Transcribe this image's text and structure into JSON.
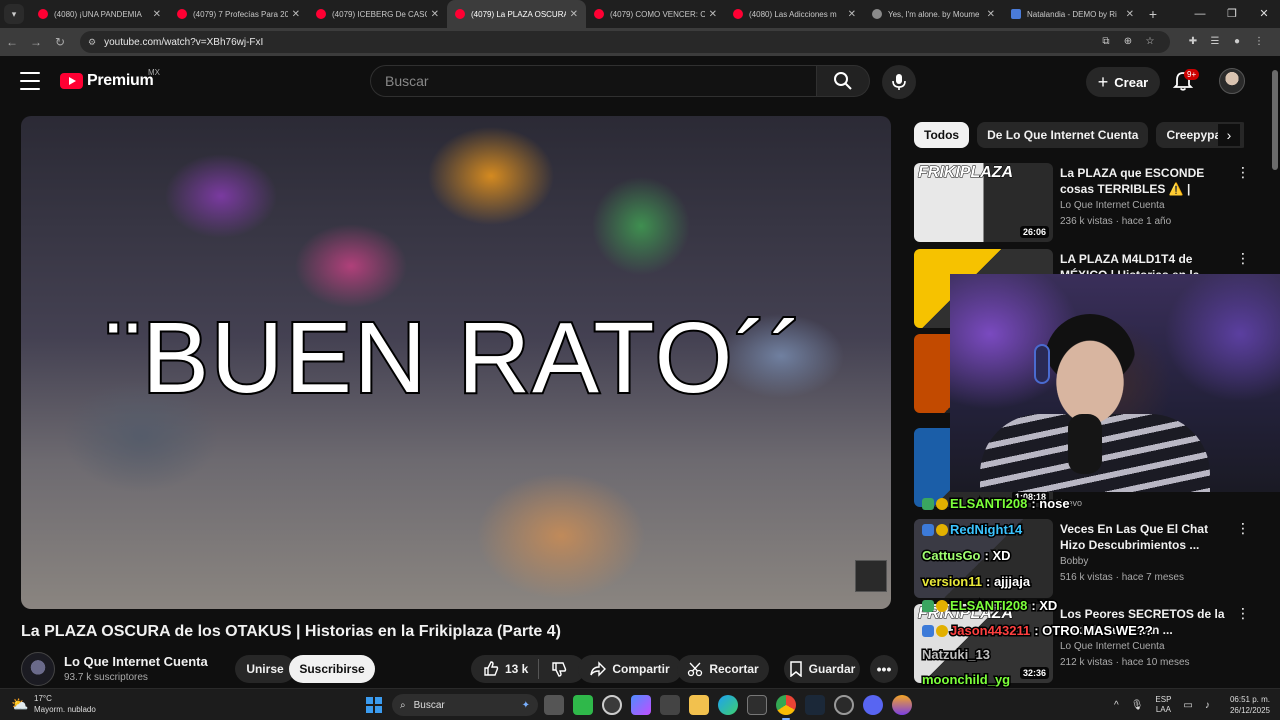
{
  "browser": {
    "tabs": [
      {
        "title": "(4080) ¡UNA PANDEMIA",
        "favicon": "youtube-icon"
      },
      {
        "title": "(4079) 7 Profecías Para 20",
        "favicon": "youtube-icon"
      },
      {
        "title": "(4079) ICEBERG De CASO",
        "favicon": "youtube-icon"
      },
      {
        "title": "(4079) La PLAZA OSCURA",
        "favicon": "youtube-icon",
        "active": true
      },
      {
        "title": "(4079) COMO VENCER: C",
        "favicon": "youtube-icon"
      },
      {
        "title": "(4080) Las Adicciones m",
        "favicon": "youtube-icon"
      },
      {
        "title": "Yes, I'm alone. by Moume",
        "favicon": "generic-icon"
      },
      {
        "title": "Natalandia - DEMO by Ri",
        "favicon": "blue-square-icon"
      }
    ],
    "url": "youtube.com/watch?v=XBh76wj-FxI"
  },
  "masthead": {
    "brand": "Premium",
    "region": "MX",
    "search_placeholder": "Buscar",
    "create_label": "Crear",
    "notif_count": "9+"
  },
  "player": {
    "overlay_text": "¨BUEN RATO´´"
  },
  "video": {
    "title": "La PLAZA OSCURA de los OTAKUS | Historias en la Frikiplaza (Parte 4)",
    "channel": "Lo Que Internet Cuenta",
    "subscribers": "93.7 k suscriptores",
    "join_label": "Unirse",
    "subscribe_label": "Suscribirse",
    "likes": "13 k",
    "share_label": "Compartir",
    "clip_label": "Recortar",
    "save_label": "Guardar"
  },
  "chips": [
    "Todos",
    "De Lo Que Internet Cuenta",
    "Creepypasta"
  ],
  "recommendations": [
    {
      "title": "La PLAZA que ESCONDE cosas TERRIBLES ⚠️ | Historias en l...",
      "channel": "Lo Que Internet Cuenta",
      "meta": "236 k vistas · hace 1 año",
      "duration": "26:06",
      "thumb_text": "FRIKIPLAZA"
    },
    {
      "title": "LA PLAZA M4LD1T4 de MÉXICO | Historias en la...",
      "channel": "",
      "meta": "",
      "duration": "",
      "thumb_text": ""
    },
    {
      "title": "",
      "channel": "",
      "meta": "",
      "duration": "",
      "thumb_text": ""
    },
    {
      "title": "",
      "channel": "",
      "meta": "",
      "duration": "1:08:18",
      "thumb_text": ""
    },
    {
      "title": "Veces En Las Que El Chat Hizo Descubrimientos ...",
      "channel": "Bobby",
      "meta": "516 k vistas · hace 7 meses",
      "duration": "",
      "thumb_text": ""
    },
    {
      "title": "Los Peores SECRETOS de la Frikiplaza ft. Stan ...",
      "channel": "Lo Que Internet Cuenta",
      "meta": "212 k vistas · hace 10 meses",
      "duration": "32:36",
      "thumb_text": "FRIKIPLAZA"
    }
  ],
  "rec_badge": "Nuevo",
  "chat": [
    {
      "user": "ELSANTI208",
      "msg": ": nose",
      "color": "#7cff3a"
    },
    {
      "user": "RedNight14",
      "msg": "",
      "color": "#3cc4ff"
    },
    {
      "user": "CattusGo",
      "msg": ": XD",
      "color": "#a0ff70"
    },
    {
      "user": "version11",
      "msg": ": ajjjaja",
      "color": "#e8e83a"
    },
    {
      "user": "ELSANTI208",
      "msg": ": XD",
      "color": "#7cff3a"
    },
    {
      "user": "Jason443211",
      "msg": ": OTRO MAS WE??",
      "color": "#ff4040"
    },
    {
      "user": "Natzuki_13",
      "msg": "",
      "color": "#c0c0c0"
    },
    {
      "user": "moonchild_yg",
      "msg": "",
      "color": "#7cff3a"
    }
  ],
  "taskbar": {
    "weather_temp": "17°C",
    "weather_desc": "Mayorm. nublado",
    "search_label": "Buscar",
    "lang_top": "ESP",
    "lang_bottom": "LAA",
    "time": "06:51 p. m.",
    "date": "26/12/2025"
  },
  "colors": {
    "youtube_red": "#ff0033",
    "background": "#0f0f0f",
    "chip_active": "#f1f1f1"
  }
}
